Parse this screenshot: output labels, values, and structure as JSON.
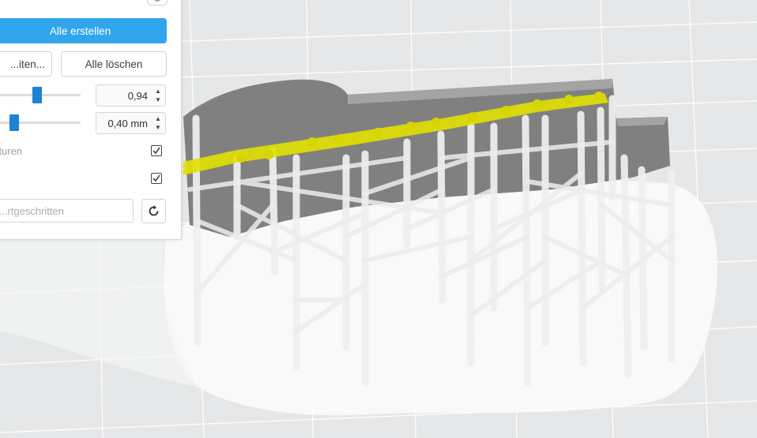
{
  "panel": {
    "help_icon": "info-icon",
    "create_all_button": "Alle erstellen",
    "edit_button_partial": "...iten...",
    "delete_all_button": "Alle löschen",
    "slider1": {
      "level": 0.5,
      "value": "0,94"
    },
    "slider2": {
      "level": 0.15,
      "value": "0,40 mm"
    },
    "checkbox1": {
      "label_partial": "...tturen",
      "checked": true
    },
    "checkbox2": {
      "checked": true
    },
    "advanced_field": {
      "placeholder_partial": "...rtgeschritten"
    },
    "reset_icon": "reset-icon"
  },
  "colors": {
    "accent": "#32a6ec",
    "slider_thumb": "#1e82d6",
    "highlight": "#e6e300",
    "model_gray": "#7d7d7d",
    "support": "#f2f2f2"
  }
}
